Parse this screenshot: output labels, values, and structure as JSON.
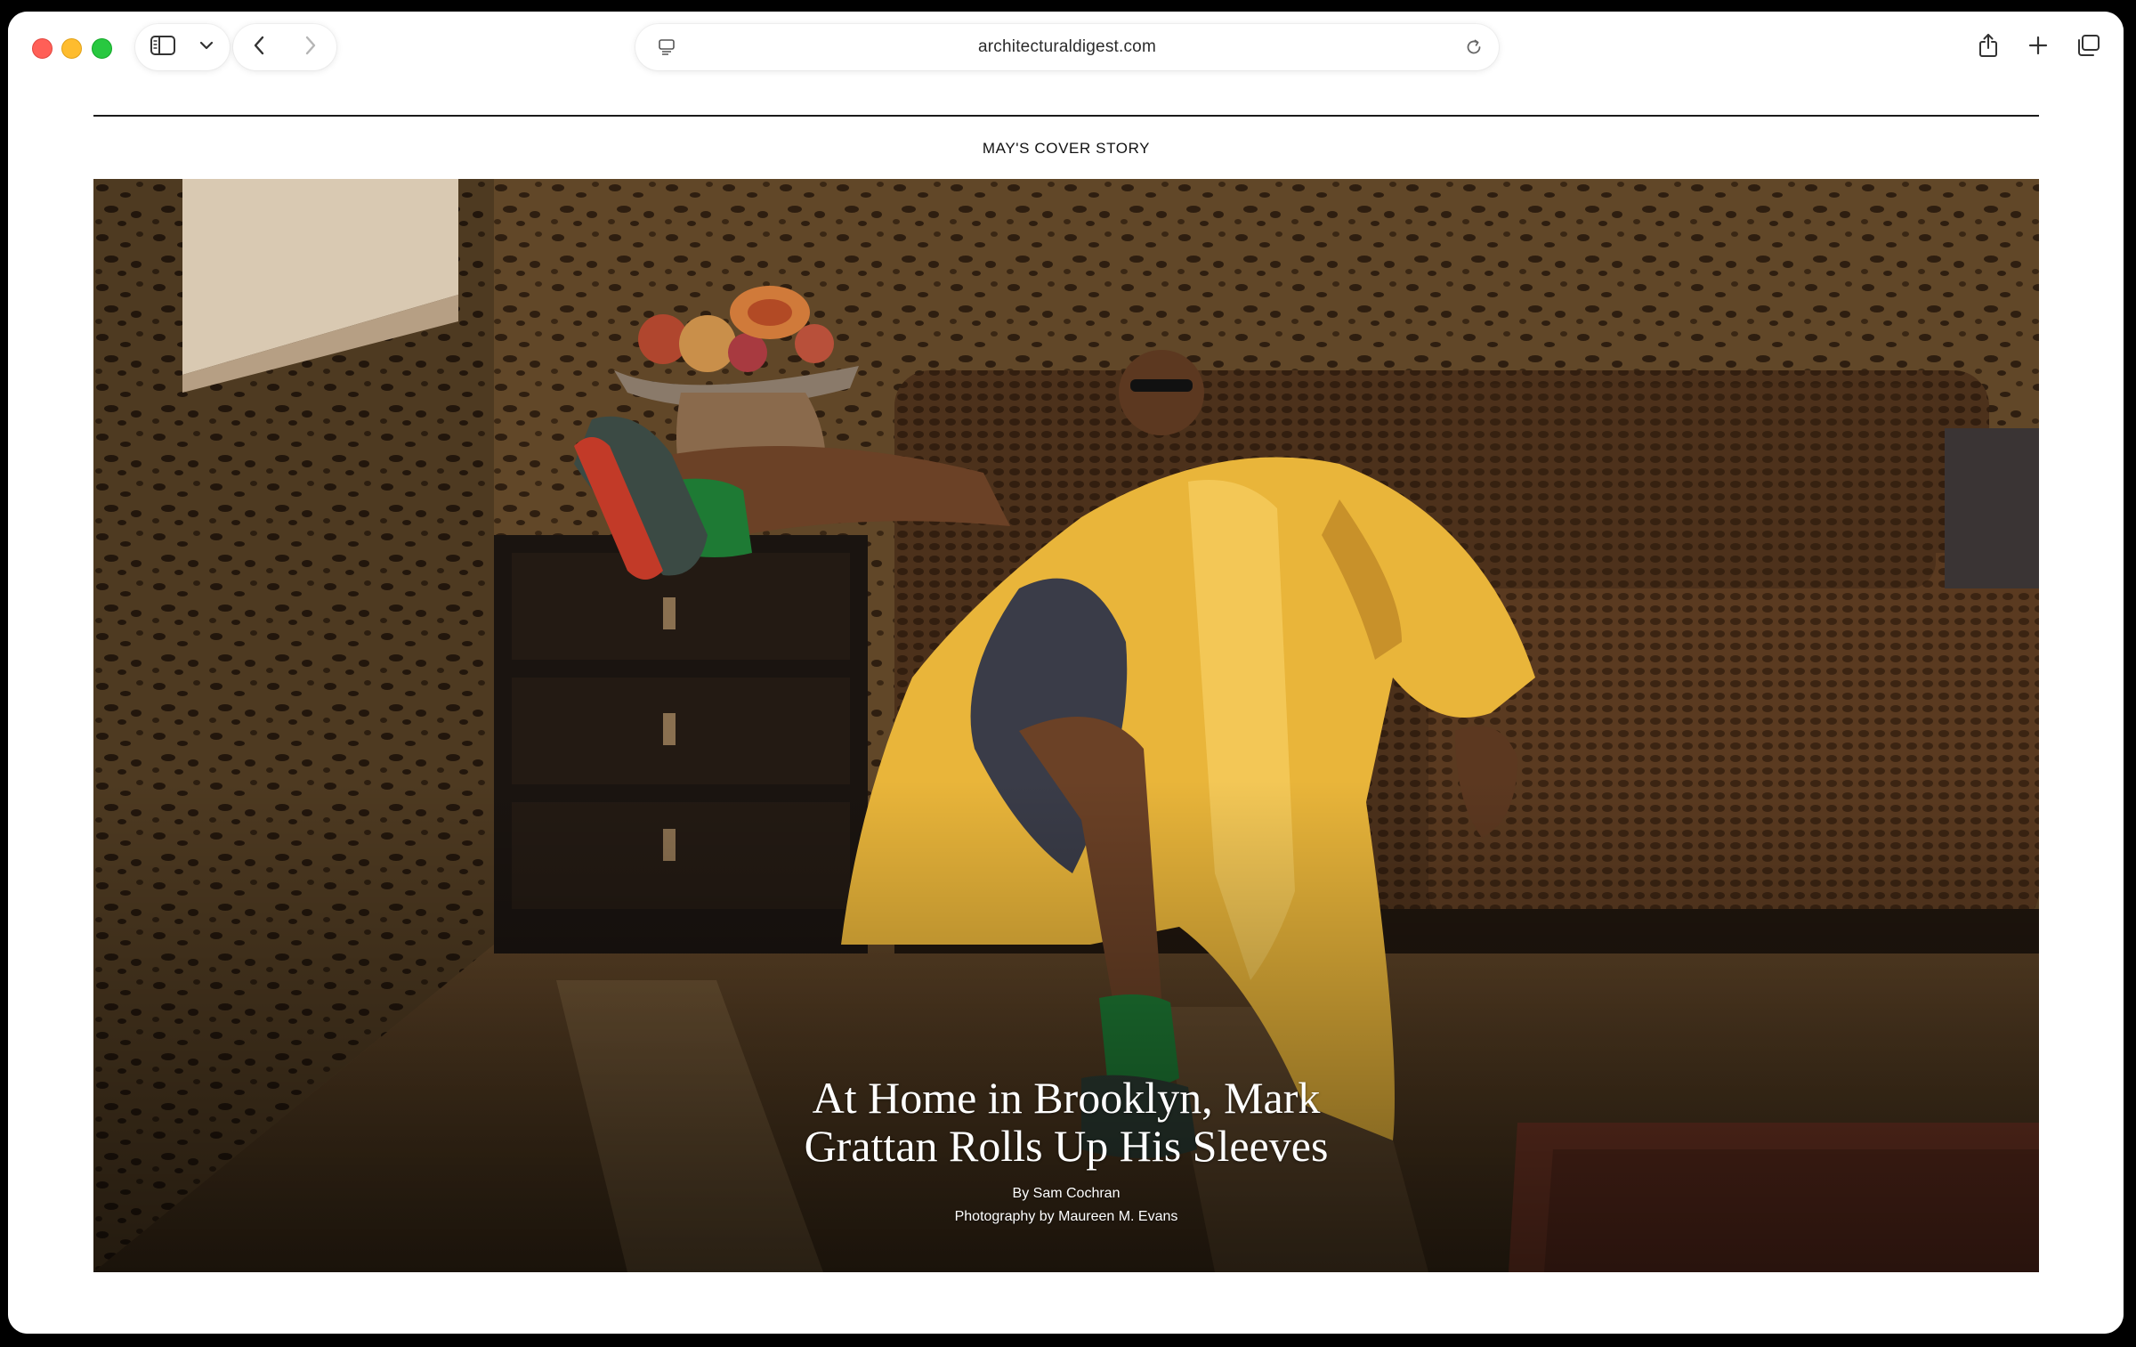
{
  "browser": {
    "address": {
      "url": "architecturaldigest.com"
    },
    "icons": {
      "sidebar": "sidebar-icon",
      "tab_overview_chevron": "chevron-down-icon",
      "back": "chevron-left-icon",
      "forward": "chevron-right-icon",
      "page_menu": "page-menu-icon",
      "reload": "reload-icon",
      "share": "share-icon",
      "new_tab": "plus-icon",
      "tabs": "tab-overview-icon"
    },
    "colors": {
      "close": "#ff5f57",
      "minimize": "#febc2e",
      "zoom": "#28c840"
    }
  },
  "article": {
    "kicker": "MAY'S COVER STORY",
    "headline": "At Home in Brooklyn, Mark Grattan Rolls Up His Sleeves",
    "byline": "By Sam Cochran",
    "photo_credit": "Photography by Maureen M. Evans"
  }
}
